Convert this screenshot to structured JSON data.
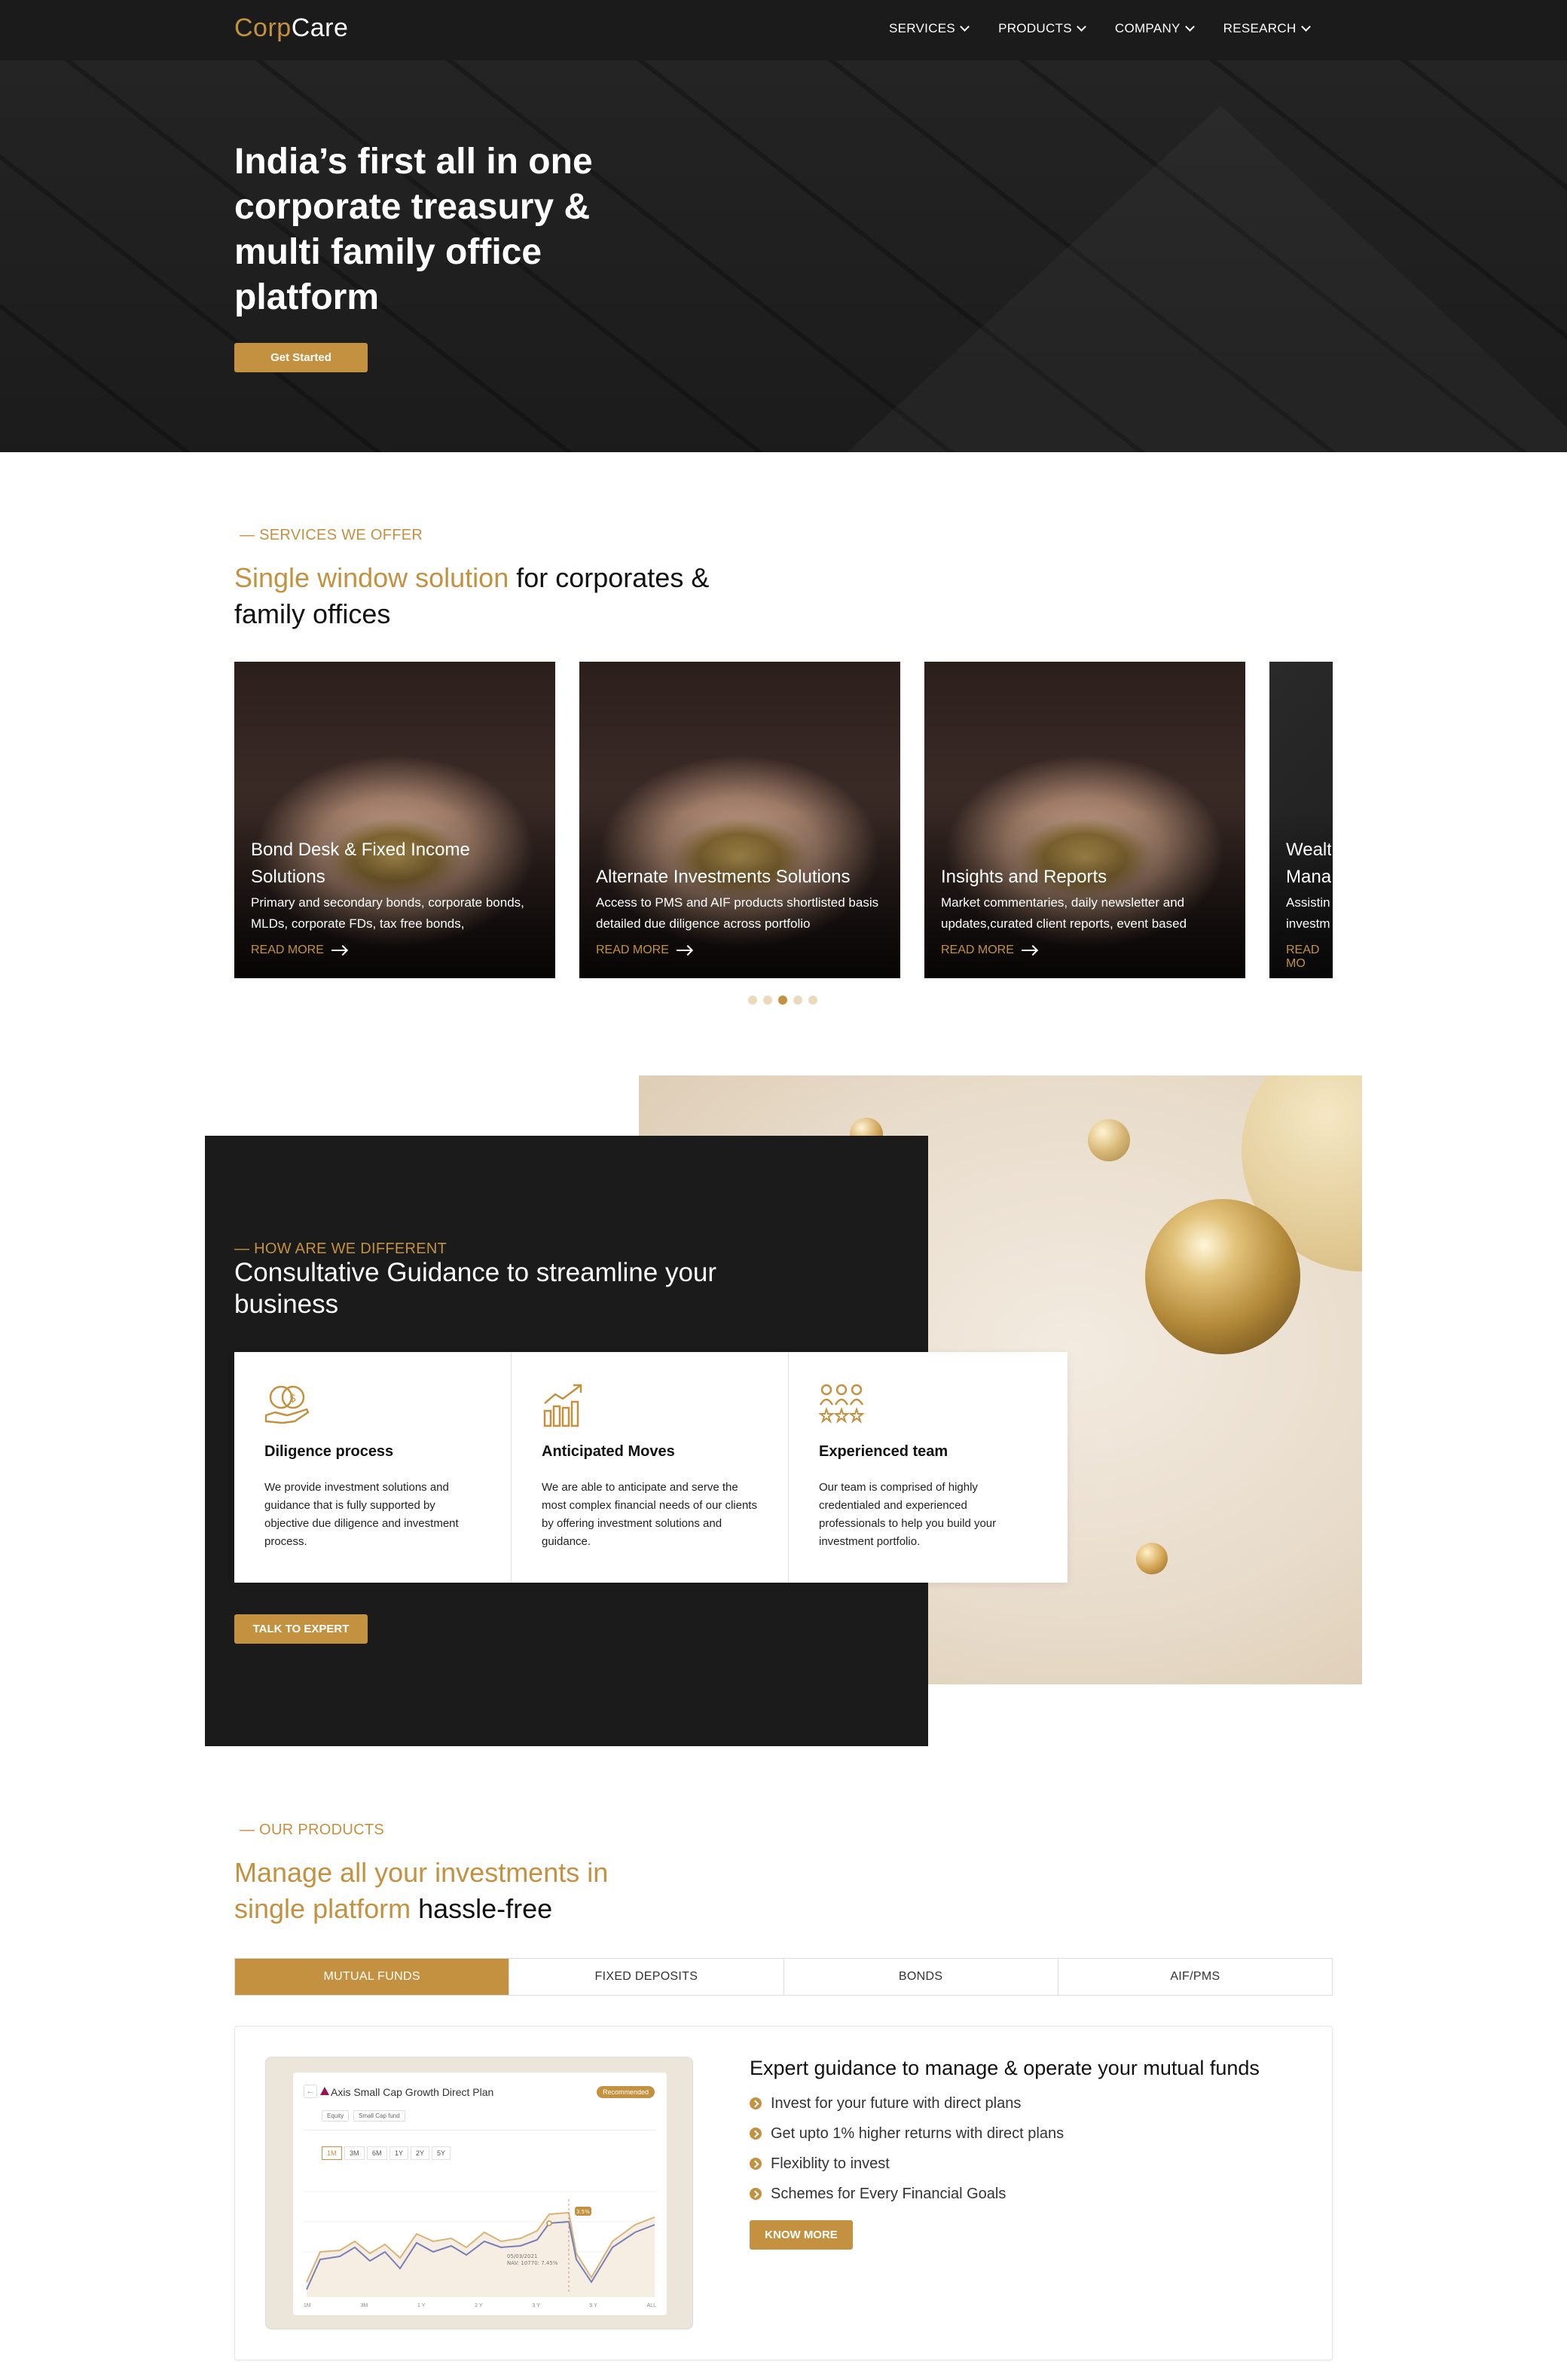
{
  "nav": {
    "logo_corp": "Corp",
    "logo_care": "Care",
    "items": [
      {
        "label": "SERVICES"
      },
      {
        "label": "PRODUCTS"
      },
      {
        "label": "COMPANY"
      },
      {
        "label": "RESEARCH"
      }
    ]
  },
  "hero": {
    "title": "India’s first all in one corporate treasury & multi family office platform",
    "cta": "Get Started"
  },
  "services": {
    "eyebrow": "— SERVICES WE OFFER",
    "title_highlight": "Single window solution",
    "title_rest": " for corporates & family offices",
    "cards": [
      {
        "title": "Bond Desk & Fixed Income Solutions",
        "desc": "Primary and secondary bonds, corporate bonds, MLDs, corporate FDs, tax free bonds,",
        "link": "READ MORE"
      },
      {
        "title": "Alternate Investments Solutions",
        "desc": "Access to PMS and AIF products shortlisted basis detailed due diligence across portfolio",
        "link": "READ MORE"
      },
      {
        "title": "Insights and Reports",
        "desc": "Market commentaries, daily newsletter and updates,curated client reports, event based",
        "link": "READ MORE"
      },
      {
        "title": "Wealth Mana",
        "desc": "Assistin investm",
        "link": "READ MO"
      }
    ],
    "carousel": {
      "total": 5,
      "active": 3
    }
  },
  "different": {
    "eyebrow": "— HOW ARE WE DIFFERENT",
    "title": "Consultative Guidance to streamline your business",
    "features": [
      {
        "icon": "coins-hand-icon",
        "title": "Diligence process",
        "desc": "We provide investment solutions and guidance that is fully supported by objective due diligence and investment process."
      },
      {
        "icon": "growth-chart-icon",
        "title": "Anticipated Moves",
        "desc": "We are able to anticipate and serve the most complex financial needs of our clients by offering investment solutions and guidance."
      },
      {
        "icon": "team-stars-icon",
        "title": "Experienced team",
        "desc": "Our team is comprised of highly credentialed and experienced professionals to help you build your investment portfolio."
      }
    ],
    "cta": "TALK TO EXPERT"
  },
  "products": {
    "eyebrow": "— OUR PRODUCTS",
    "title_highlight": "Manage all your investments in single platform",
    "title_rest": " hassle-free",
    "tabs": [
      {
        "label": "MUTUAL FUNDS",
        "active": true
      },
      {
        "label": "FIXED DEPOSITS",
        "active": false
      },
      {
        "label": "BONDS",
        "active": false
      },
      {
        "label": "AIF/PMS",
        "active": false
      }
    ],
    "panel": {
      "title": "Expert guidance to manage & operate your mutual funds",
      "bullets": [
        "Invest for your future with direct plans",
        "Get upto 1% higher returns with direct plans",
        "Flexiblity to invest",
        "Schemes for Every Financial Goals"
      ],
      "cta": "KNOW MORE",
      "mockup": {
        "fund_name": "Axis Small Cap Growth Direct Plan",
        "badge": "Recommended",
        "chips": [
          "Equity",
          "Small Cap fund"
        ],
        "periods": [
          "1M",
          "3M",
          "6M",
          "1Y",
          "2Y",
          "5Y"
        ],
        "x_labels": [
          "1M",
          "3M",
          "1 Y",
          "2 Y",
          "3 Y",
          "5 Y",
          "ALL"
        ],
        "tooltip_date": "05/03/2021",
        "tooltip_value": "NAV: 10770: 7.45%",
        "marker": "3.5%"
      }
    }
  },
  "colors": {
    "accent": "#c3913f",
    "dark": "#1b1b1b"
  }
}
